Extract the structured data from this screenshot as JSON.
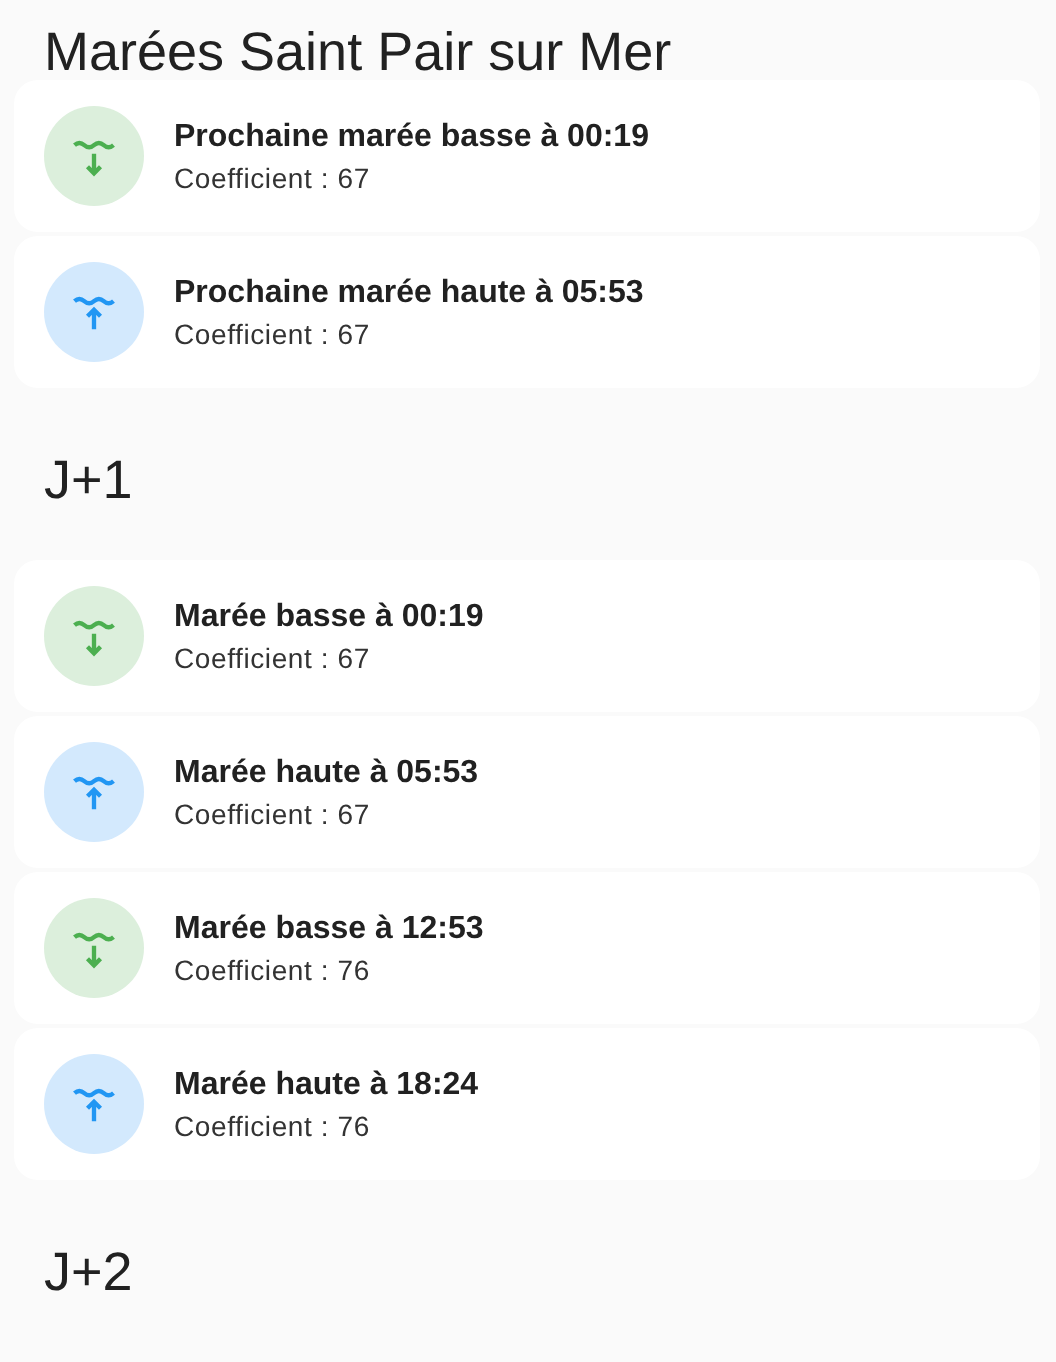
{
  "sections": [
    {
      "title": "Marées Saint Pair sur Mer",
      "events": [
        {
          "kind": "low",
          "label": "Prochaine marée basse à 00:19",
          "detail": "Coefficient : 67"
        },
        {
          "kind": "high",
          "label": "Prochaine marée haute à 05:53",
          "detail": "Coefficient : 67"
        }
      ]
    },
    {
      "title": "J+1",
      "events": [
        {
          "kind": "low",
          "label": "Marée basse à 00:19",
          "detail": "Coefficient : 67"
        },
        {
          "kind": "high",
          "label": "Marée haute à 05:53",
          "detail": "Coefficient : 67"
        },
        {
          "kind": "low",
          "label": "Marée basse à 12:53",
          "detail": "Coefficient : 76"
        },
        {
          "kind": "high",
          "label": "Marée haute à 18:24",
          "detail": "Coefficient : 76"
        }
      ]
    },
    {
      "title": "J+2"
    }
  ]
}
